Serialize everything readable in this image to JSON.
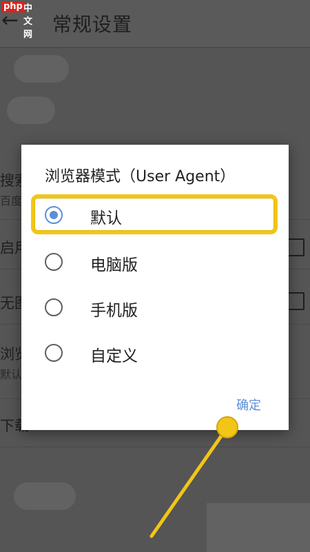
{
  "watermark": {
    "logo": "php",
    "text": "中文网"
  },
  "header": {
    "title": "常规设置",
    "back_icon": "arrow-left-icon"
  },
  "background_rows": [
    {
      "label": "搜索",
      "sub": "百度"
    },
    {
      "label": "启用"
    },
    {
      "label": "无图"
    },
    {
      "label": "浏览",
      "sub": "默认"
    },
    {
      "label": "下载"
    }
  ],
  "dialog": {
    "title": "浏览器模式（User Agent）",
    "options": [
      {
        "label": "默认",
        "selected": true
      },
      {
        "label": "电脑版",
        "selected": false
      },
      {
        "label": "手机版",
        "selected": false
      },
      {
        "label": "自定义",
        "selected": false
      }
    ],
    "ok_label": "确定"
  },
  "colors": {
    "accent": "#5b8ed9",
    "highlight": "#f2c618",
    "scrim": "#555555"
  }
}
